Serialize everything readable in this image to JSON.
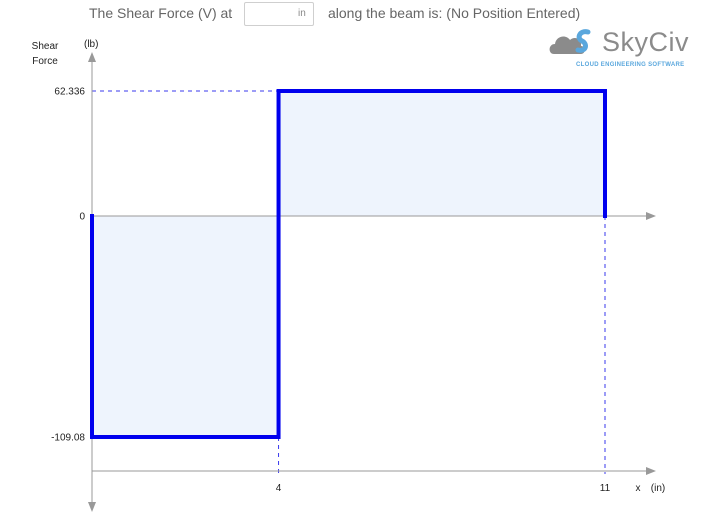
{
  "query": {
    "prefix": "The Shear Force (V) at",
    "input_value": "",
    "input_unit": "in",
    "suffix": "along the beam is: (No Position Entered)"
  },
  "logo": {
    "brand": "SkyCiv",
    "tagline": "CLOUD ENGINEERING SOFTWARE"
  },
  "chart_data": {
    "type": "area",
    "ylabel_line1": "Shear",
    "ylabel_line2": "Force",
    "yunit": "(lb)",
    "xlabel": "x",
    "xunit": "(in)",
    "x": [
      0,
      0,
      4,
      4,
      11,
      11
    ],
    "y": [
      0,
      -109.08,
      -109.08,
      62.336,
      62.336,
      0
    ],
    "ylim": [
      -109.08,
      62.336
    ],
    "xlim": [
      0,
      11
    ],
    "yticks": [
      "62.336",
      "0",
      "-109.08"
    ],
    "xticks": [
      "4",
      "11"
    ],
    "line_color": "#0000ee",
    "fill_color": "#eef4fd",
    "guide_color": "#3a3aee"
  }
}
